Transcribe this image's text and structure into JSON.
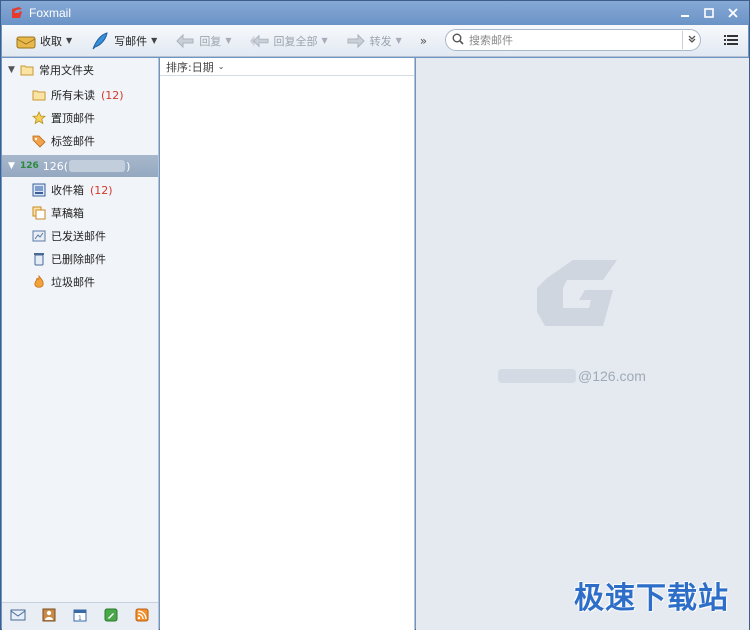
{
  "window": {
    "title": "Foxmail"
  },
  "toolbar": {
    "receive_label": "收取",
    "compose_label": "写邮件",
    "reply_label": "回复",
    "reply_all_label": "回复全部",
    "forward_label": "转发",
    "more_label": "»",
    "search_placeholder": "搜索邮件"
  },
  "sidebar": {
    "favorites": {
      "title": "常用文件夹",
      "items": [
        {
          "label": "所有未读",
          "count": "(12)"
        },
        {
          "label": "置顶邮件"
        },
        {
          "label": "标签邮件"
        }
      ]
    },
    "account": {
      "prefix": "126(",
      "suffix": ")",
      "folders": [
        {
          "label": "收件箱",
          "count": "(12)"
        },
        {
          "label": "草稿箱"
        },
        {
          "label": "已发送邮件"
        },
        {
          "label": "已删除邮件"
        },
        {
          "label": "垃圾邮件"
        }
      ]
    }
  },
  "list": {
    "sort_label": "排序:日期"
  },
  "preview": {
    "email_suffix": "@126.com"
  },
  "watermark": {
    "text": "极速下载站"
  },
  "colors": {
    "accent": "#6b93c6",
    "count_red": "#d23a2a",
    "selected_row": "#9fb1c8"
  }
}
